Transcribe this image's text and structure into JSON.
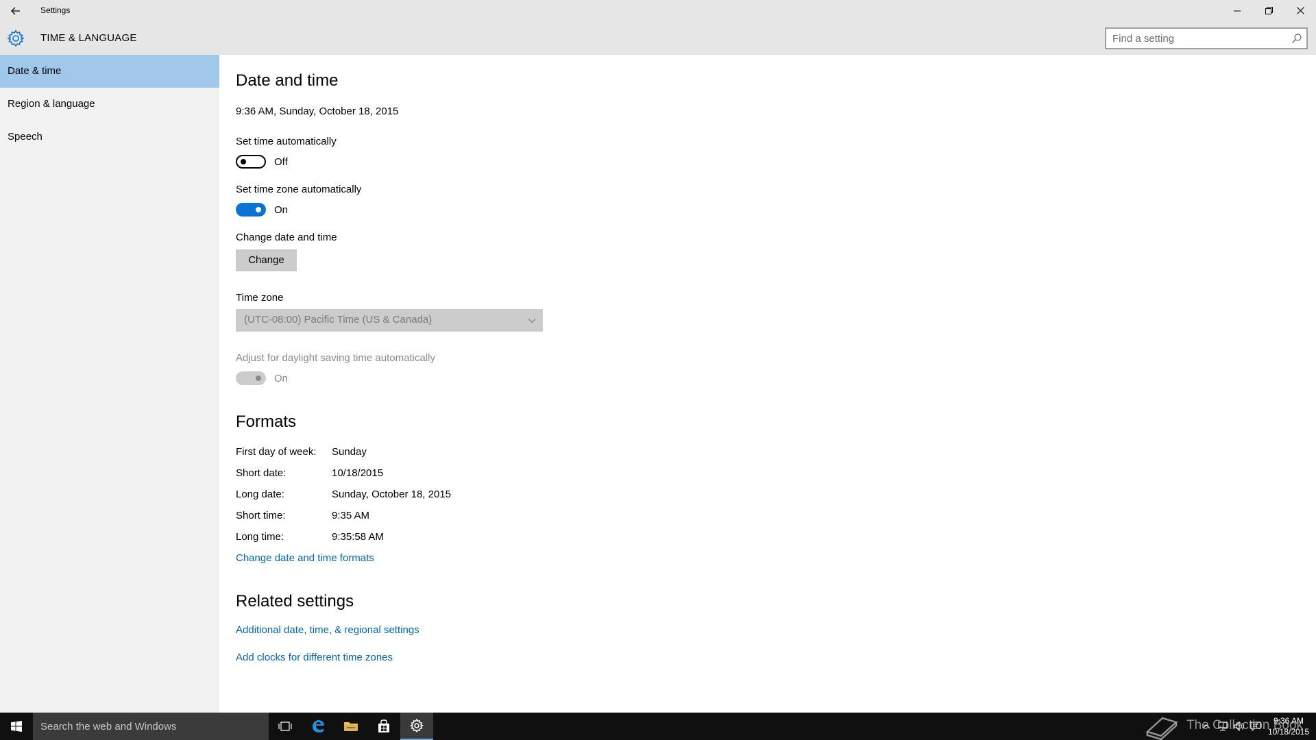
{
  "window": {
    "title": "Settings"
  },
  "header": {
    "title": "TIME & LANGUAGE",
    "search_placeholder": "Find a setting"
  },
  "sidebar": {
    "items": [
      {
        "label": "Date & time",
        "active": true
      },
      {
        "label": "Region & language",
        "active": false
      },
      {
        "label": "Speech",
        "active": false
      }
    ]
  },
  "main": {
    "date_time_heading": "Date and time",
    "current_datetime": "9:36 AM, Sunday, October 18, 2015",
    "set_time_auto": {
      "label": "Set time automatically",
      "state": "Off"
    },
    "set_timezone_auto": {
      "label": "Set time zone automatically",
      "state": "On"
    },
    "change_datetime": {
      "label": "Change date and time",
      "button": "Change"
    },
    "time_zone": {
      "label": "Time zone",
      "value": "(UTC-08:00) Pacific Time (US & Canada)"
    },
    "daylight": {
      "label": "Adjust for daylight saving time automatically",
      "state": "On"
    },
    "formats_heading": "Formats",
    "formats": [
      {
        "label": "First day of week:",
        "value": "Sunday"
      },
      {
        "label": "Short date:",
        "value": "10/18/2015"
      },
      {
        "label": "Long date:",
        "value": "Sunday, October 18, 2015"
      },
      {
        "label": "Short time:",
        "value": "9:35 AM"
      },
      {
        "label": "Long time:",
        "value": "9:35:58 AM"
      }
    ],
    "change_formats_link": "Change date and time formats",
    "related_heading": "Related settings",
    "related_links": [
      "Additional date, time, & regional settings",
      "Add clocks for different time zones"
    ]
  },
  "taskbar": {
    "search_placeholder": "Search the web and Windows",
    "clock_time": "9:36 AM",
    "clock_date": "10/18/2015",
    "watermark": "The Collection Book"
  },
  "colors": {
    "accent": "#0a74d4",
    "sidebar_selected": "#9fc8ea",
    "link": "#0063b1",
    "taskbar": "#101010"
  }
}
